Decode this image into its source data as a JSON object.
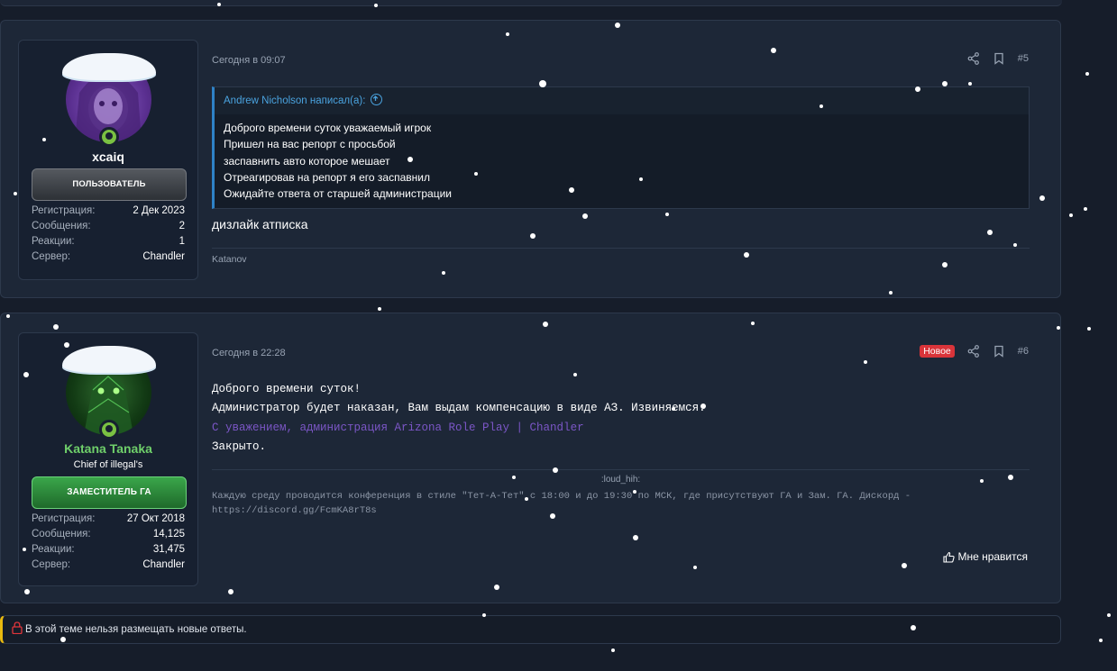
{
  "posts": [
    {
      "date": "Сегодня в 09:07",
      "number": "#5",
      "badge": "",
      "user": {
        "name": "xcaiq",
        "title": "",
        "rank": "ПОЛЬЗОВАТЕЛЬ",
        "stats": [
          {
            "label": "Регистрация:",
            "value": "2 Дек 2023"
          },
          {
            "label": "Сообщения:",
            "value": "2"
          },
          {
            "label": "Реакции:",
            "value": "1"
          },
          {
            "label": "Сервер:",
            "value": "Chandler"
          }
        ]
      },
      "quote": {
        "author": "Andrew Nicholson написал(а):",
        "lines": [
          "Доброго времени суток уважаемый игрок",
          "Пришел на вас репорт с просьбой",
          "заспавнить авто которое мешает",
          "Отреагировав на репорт я его заспавнил",
          "Ожидайте ответа от старшей администрации"
        ]
      },
      "text": "дизлайк атписка",
      "signature": "Katanov"
    },
    {
      "date": "Сегодня в 22:28",
      "number": "#6",
      "badge": "Новое",
      "user": {
        "name": "Katana Tanaka",
        "title": "Chief of illegal's",
        "rank": "ЗАМЕСТИТЕЛЬ ГА",
        "stats": [
          {
            "label": "Регистрация:",
            "value": "27 Окт 2018"
          },
          {
            "label": "Сообщения:",
            "value": "14,125"
          },
          {
            "label": "Реакции:",
            "value": "31,475"
          },
          {
            "label": "Сервер:",
            "value": "Chandler"
          }
        ]
      },
      "lines": [
        "Доброго времени суток!",
        "Администратор будет наказан, Вам выдам компенсацию в виде АЗ. Извиняемся.",
        "С уважением, администрация Arizona Role Play | Chandler",
        "Закрыто."
      ],
      "signature_title": ":loud_hih:",
      "signature_lines": [
        "Каждую среду проводится конференция в стиле \"Тет-А-Тет\" с 18:00 и до 19:30 по МСК, где присутствуют ГА и Зам. ГА. Дискорд -",
        "https://discord.gg/FcmKA8rT8s"
      ],
      "like_label": "Мне нравится"
    }
  ],
  "locked_notice": "В этой теме нельзя размещать новые ответы.",
  "icons": {
    "share": "share-icon",
    "bookmark": "bookmark-icon",
    "quote_jump": "arrow-up-circle-icon",
    "like": "thumbs-up-icon",
    "lock": "lock-icon",
    "online": "online-status-icon"
  },
  "colors": {
    "page_bg": "#161d2a",
    "post_bg": "#1d2737",
    "accent_blue": "#4aa3df",
    "moderator_green": "#6fcf6a",
    "new_badge": "#d9343a",
    "signature_purple": "#7b56c6",
    "lock_accent": "#e8b90f"
  }
}
